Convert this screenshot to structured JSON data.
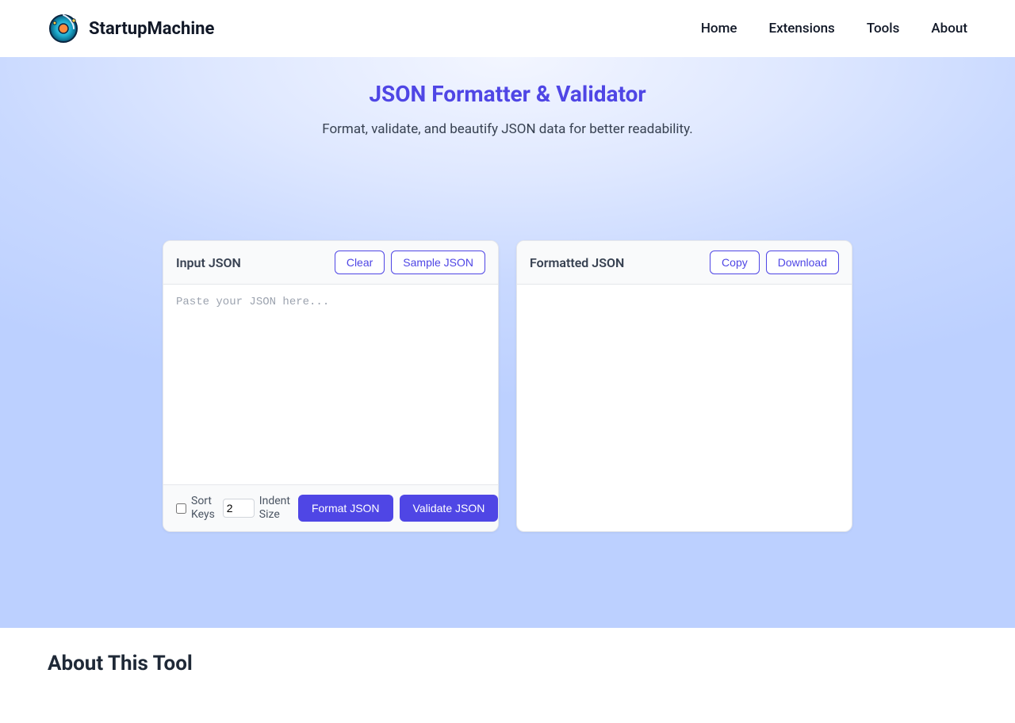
{
  "brand": {
    "name": "StartupMachine"
  },
  "nav": {
    "links": [
      "Home",
      "Extensions",
      "Tools",
      "About"
    ]
  },
  "hero": {
    "title": "JSON Formatter & Validator",
    "subtitle": "Format, validate, and beautify JSON data for better readability."
  },
  "input_panel": {
    "title": "Input JSON",
    "clear_label": "Clear",
    "sample_label": "Sample JSON",
    "placeholder": "Paste your JSON here...",
    "value": "",
    "sort_keys_label": "Sort Keys",
    "sort_keys_checked": false,
    "indent_size_label": "Indent Size",
    "indent_size_value": "2",
    "format_label": "Format JSON",
    "validate_label": "Validate JSON"
  },
  "output_panel": {
    "title": "Formatted JSON",
    "copy_label": "Copy",
    "download_label": "Download",
    "content": ""
  },
  "about": {
    "heading": "About This Tool"
  },
  "colors": {
    "accent": "#4f46e5"
  }
}
